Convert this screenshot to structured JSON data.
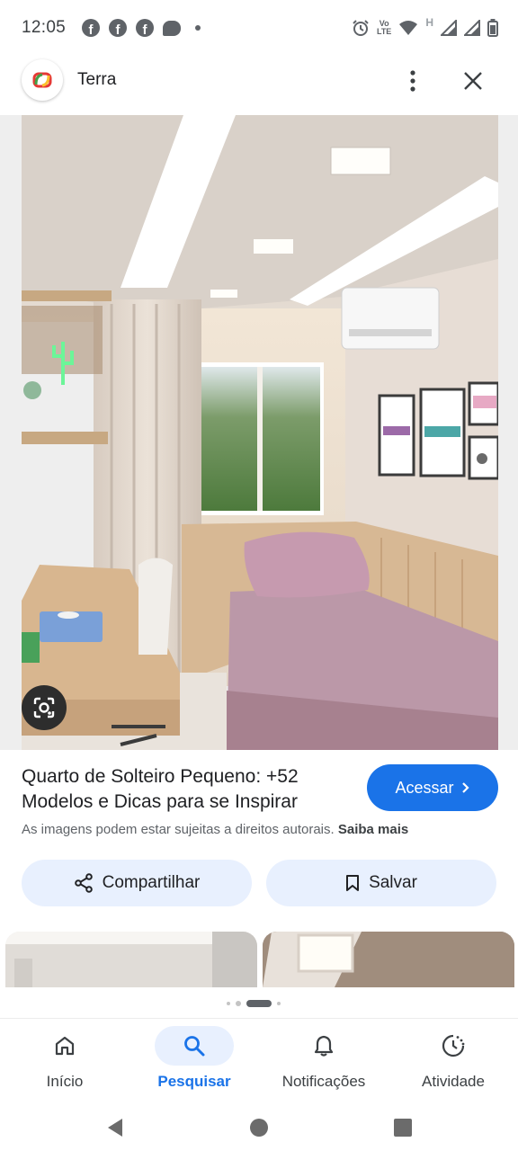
{
  "status_bar": {
    "time": "12:05",
    "volte_top": "Vo",
    "volte_bottom": "LTE",
    "network": "H"
  },
  "app_bar": {
    "site_name": "Terra"
  },
  "result": {
    "title": "Quarto de Solteiro Pequeno: +52 Modelos e Dicas para se Inspirar",
    "visit_label": "Acessar",
    "disclaimer": "As imagens podem estar sujeitas a direitos autorais.",
    "learn_more": "Saiba mais",
    "share_label": "Compartilhar",
    "save_label": "Salvar"
  },
  "bottom_nav": {
    "items": [
      {
        "label": "Início",
        "icon": "home-icon"
      },
      {
        "label": "Pesquisar",
        "icon": "search-icon"
      },
      {
        "label": "Notificações",
        "icon": "bell-icon"
      },
      {
        "label": "Atividade",
        "icon": "activity-icon"
      }
    ],
    "active_index": 1
  },
  "colors": {
    "accent": "#1a73e8",
    "chip_bg": "#e8f0fe",
    "text_primary": "#202124",
    "text_secondary": "#5f6368"
  }
}
